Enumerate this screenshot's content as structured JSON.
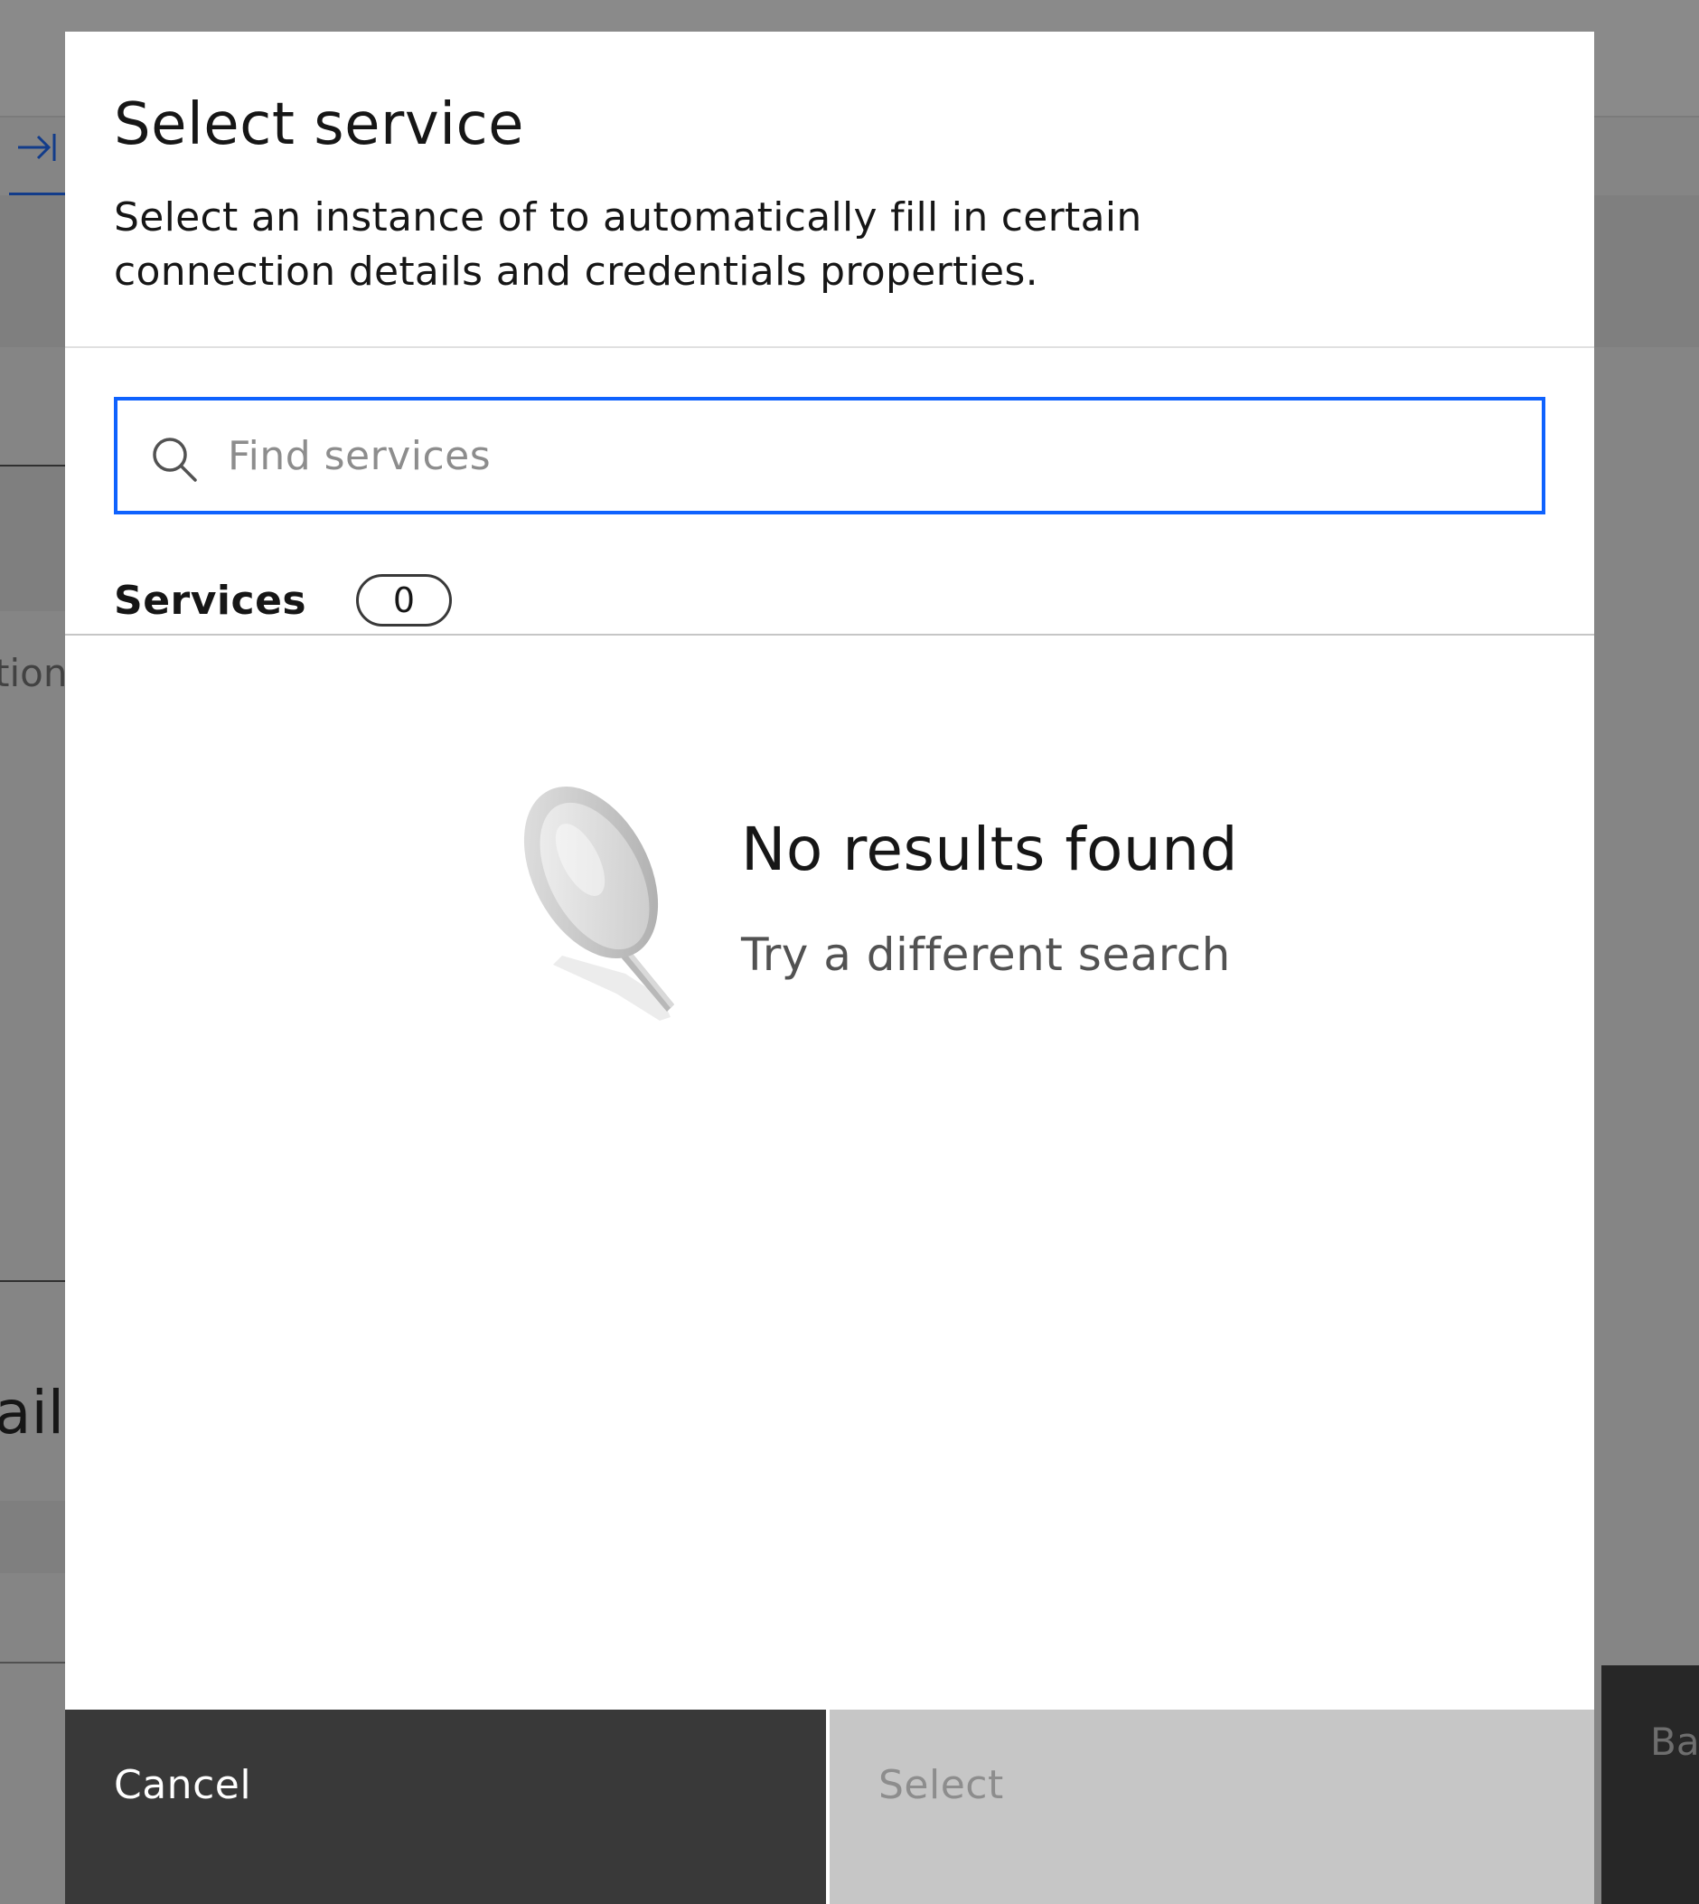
{
  "background": {
    "fragment_text_1": "tion",
    "fragment_text_2": "ails",
    "fragment_button": "Ba"
  },
  "modal": {
    "title": "Select service",
    "description": "Select an instance of to automatically fill in certain connection details and credentials properties.",
    "search": {
      "placeholder": "Find services",
      "value": ""
    },
    "services": {
      "label": "Services",
      "count": "0"
    },
    "empty_state": {
      "title": "No results found",
      "subtitle": "Try a different search",
      "icon": "magnifying-glass-icon"
    },
    "footer": {
      "cancel_label": "Cancel",
      "select_label": "Select"
    }
  },
  "colors": {
    "focus_blue": "#0f62fe",
    "overlay": "rgba(22,22,22,0.5)",
    "cancel_bg": "#393939",
    "select_disabled_bg": "#c6c6c6"
  }
}
